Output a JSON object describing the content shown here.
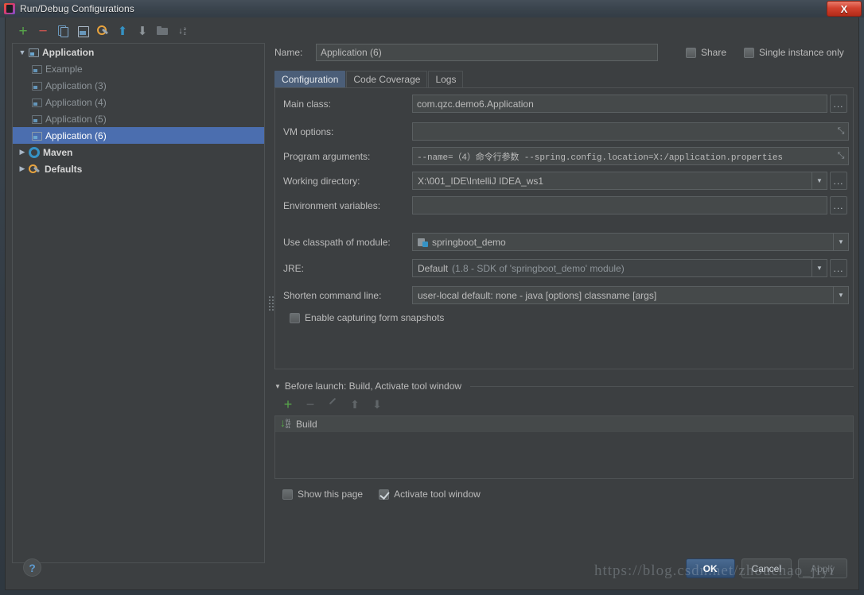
{
  "window": {
    "title": "Run/Debug Configurations",
    "close_label": "X",
    "app_icon": "intellij-idea-icon"
  },
  "tree_toolbar": {
    "items": [
      {
        "name": "add-configuration-button",
        "icon": "plus-icon",
        "glyph": "+"
      },
      {
        "name": "remove-configuration-button",
        "icon": "minus-icon",
        "glyph": "−"
      },
      {
        "name": "copy-configuration-button",
        "icon": "copy-icon",
        "glyph": ""
      },
      {
        "name": "save-configuration-button",
        "icon": "save-icon",
        "glyph": ""
      },
      {
        "name": "edit-defaults-button",
        "icon": "wrench-icon",
        "glyph": ""
      },
      {
        "name": "move-up-button",
        "icon": "arrow-up-icon",
        "glyph": "⬆"
      },
      {
        "name": "move-down-button",
        "icon": "arrow-down-icon",
        "glyph": "⬇"
      },
      {
        "name": "create-folder-button",
        "icon": "folder-icon",
        "glyph": ""
      },
      {
        "name": "sort-configurations-button",
        "icon": "sort-az-icon",
        "glyph": "↓"
      }
    ]
  },
  "tree": {
    "nodes": [
      {
        "label": "Application",
        "icon": "run-config-icon",
        "twisty": "▼",
        "depth": 0,
        "bold": true,
        "selected": false,
        "muted": false
      },
      {
        "label": "Example",
        "icon": "run-config-icon",
        "twisty": "",
        "depth": 1,
        "bold": false,
        "selected": false,
        "muted": true
      },
      {
        "label": "Application (3)",
        "icon": "run-config-icon",
        "twisty": "",
        "depth": 1,
        "bold": false,
        "selected": false,
        "muted": true
      },
      {
        "label": "Application (4)",
        "icon": "run-config-icon",
        "twisty": "",
        "depth": 1,
        "bold": false,
        "selected": false,
        "muted": true
      },
      {
        "label": "Application (5)",
        "icon": "run-config-icon",
        "twisty": "",
        "depth": 1,
        "bold": false,
        "selected": false,
        "muted": true
      },
      {
        "label": "Application (6)",
        "icon": "run-config-icon",
        "twisty": "",
        "depth": 1,
        "bold": false,
        "selected": true,
        "muted": false
      },
      {
        "label": "Maven",
        "icon": "gear-icon",
        "twisty": "▶",
        "depth": 0,
        "bold": true,
        "selected": false,
        "muted": false
      },
      {
        "label": "Defaults",
        "icon": "wrench-icon",
        "twisty": "▶",
        "depth": 0,
        "bold": true,
        "selected": false,
        "muted": false
      }
    ]
  },
  "name_row": {
    "label": "Name:",
    "value": "Application (6)",
    "share": {
      "label": "Share",
      "checked": false
    },
    "single_instance": {
      "label": "Single instance only",
      "checked": false
    }
  },
  "tabs": [
    {
      "label": "Configuration",
      "active": true
    },
    {
      "label": "Code Coverage",
      "active": false
    },
    {
      "label": "Logs",
      "active": false
    }
  ],
  "config": {
    "main_class": {
      "label": "Main class:",
      "value": "com.qzc.demo6.Application"
    },
    "vm_options": {
      "label": "VM options:",
      "value": ""
    },
    "program_arguments": {
      "label": "Program arguments:",
      "value": "--name=（4）命令行参数 --spring.config.location=X:/application.properties"
    },
    "working_directory": {
      "label": "Working directory:",
      "value": "X:\\001_IDE\\IntelliJ IDEA_ws1"
    },
    "environment_variables": {
      "label": "Environment variables:",
      "value": ""
    },
    "use_classpath_of_module": {
      "label": "Use classpath of module:",
      "value": "springboot_demo",
      "icon": "module-icon"
    },
    "jre": {
      "label": "JRE:",
      "value": "Default",
      "value_detail": "(1.8 - SDK of 'springboot_demo' module)"
    },
    "shorten_command_line": {
      "label": "Shorten command line:",
      "value": "user-local default: none - java [options] classname [args]"
    },
    "enable_capturing_form_snapshots": {
      "label": "Enable capturing form snapshots",
      "checked": false
    },
    "ellipsis_label": "...",
    "dropdown_glyph": "▼",
    "expand_glyph": "⤡"
  },
  "before_launch": {
    "twisty": "▼",
    "title": "Before launch: Build, Activate tool window",
    "toolbar": [
      {
        "name": "add-task-button",
        "icon": "plus-icon",
        "glyph": "+",
        "disabled": false
      },
      {
        "name": "remove-task-button",
        "icon": "minus-icon",
        "glyph": "−",
        "disabled": true
      },
      {
        "name": "edit-task-button",
        "icon": "pencil-icon",
        "glyph": "",
        "disabled": true
      },
      {
        "name": "move-task-up-button",
        "icon": "arrow-up-icon",
        "glyph": "⬆",
        "disabled": true
      },
      {
        "name": "move-task-down-button",
        "icon": "arrow-down-icon",
        "glyph": "⬇",
        "disabled": true
      }
    ],
    "tasks": [
      {
        "label": "Build",
        "icon": "build-icon"
      }
    ],
    "show_this_page": {
      "label": "Show this page",
      "checked": false
    },
    "activate_tool_window": {
      "label": "Activate tool window",
      "checked": true
    }
  },
  "footer": {
    "help_label": "?",
    "ok_label": "OK",
    "cancel_label": "Cancel",
    "apply_label": "Apply",
    "watermark": "https://blog.csdn.net/zhouchao_jiyi"
  },
  "colors": {
    "accent_selection": "#4b6eaf",
    "panel_bg": "#3c3f41",
    "field_bg": "#45494a",
    "text": "#bbbbbb",
    "green": "#57a64a",
    "red": "#c75450",
    "blue": "#3592c4"
  }
}
